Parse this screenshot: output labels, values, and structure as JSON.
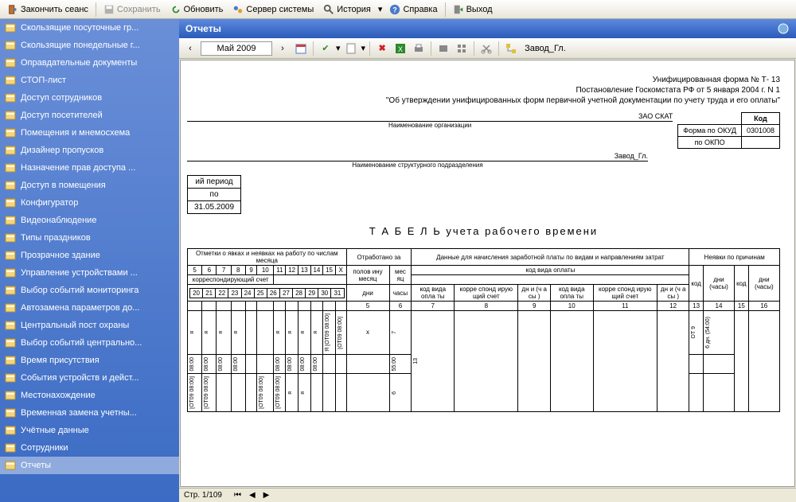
{
  "topToolbar": {
    "endSession": "Закончить сеанс",
    "save": "Сохранить",
    "refresh": "Обновить",
    "serverSystems": "Сервер системы",
    "history": "История",
    "help": "Справка",
    "exit": "Выход"
  },
  "sidebar": {
    "items": [
      "Скользящие посуточные гр...",
      "Скользящие понедельные г...",
      "Оправдательные документы",
      "СТОП-лист",
      "Доступ сотрудников",
      "Доступ посетителей",
      "Помещения и мнемосхема",
      "Дизайнер пропусков",
      "Назначение прав доступа ...",
      "Доступ в помещения",
      "Конфигуратор",
      "Видеонаблюдение",
      "Типы праздников",
      "Прозрачное здание",
      "Управление устройствами ...",
      "Выбор событий мониторинга",
      "Автозамена параметров до...",
      "Центральный пост охраны",
      "Выбор событий центрально...",
      "Время присутствия",
      "События устройств и дейст...",
      "Местонахождение",
      "Временная замена учетны...",
      "Учётные данные",
      "Сотрудники",
      "Отчеты"
    ],
    "activeIndex": 25
  },
  "titleBar": {
    "title": "Отчеты"
  },
  "subToolbar": {
    "prev": "‹",
    "next": "›",
    "date": "Май 2009",
    "zavod": "Завод_Гл."
  },
  "doc": {
    "formLine1": "Унифицированная  форма № Т- 13",
    "formLine2": "Постановление Госкомстата РФ от 5 января 2004 г. N 1",
    "formLine3": "\"Об утверждении унифицированных форм первичной учетной документации по учету труда и его оплаты\"",
    "orgName": "ЗАО СКАТ",
    "orgLabel": "Наименование организации",
    "divName": "Завод_Гл.",
    "divLabel": "Наименование структурного подразделения",
    "codeHeader": "Код",
    "okudLabel": "Форма по ОКУД",
    "okudVal": "0301008",
    "okpoLabel": "по ОКПО",
    "okpoVal": "",
    "periodLabel": "ий период",
    "periodPo": "по",
    "periodEnd": "31.05.2009",
    "title": "Т А Б Е Л Ь учета  рабочего  времени",
    "col_marks": "Отметки о явках и неявках на работу по числам месяца",
    "col_worked": "Отработано за",
    "col_payroll": "Данные для начисления заработной платы по  видам и направлениям затрат",
    "col_absence": "Неявки по причинам",
    "col_halfMonth": "полов ину месяц",
    "col_month": "мес яц",
    "col_payCode": "код вида оплаты",
    "col_corrAccount": "корреспондирующий счет",
    "col_days": "дни",
    "col_hours": "часы",
    "col_daysHours": "дни (часы)",
    "col_kod": "код",
    "col_payCodeS": "код вида опла ты",
    "col_corrS": "корре спонд ирую щий счет",
    "col_dnCha": "дн и (ч а сы )",
    "days1": [
      "5",
      "6",
      "7",
      "8",
      "9",
      "10",
      "11",
      "12",
      "13",
      "14",
      "15",
      "X"
    ],
    "days2": [
      "20",
      "21",
      "22",
      "23",
      "24",
      "25",
      "26",
      "27",
      "28",
      "29",
      "30",
      "31"
    ],
    "footerNums": [
      "5",
      "6",
      "7",
      "8",
      "9",
      "10",
      "11",
      "12",
      "13",
      "14",
      "15",
      "16"
    ],
    "r1_marks": [
      "я",
      "я",
      "я",
      "я",
      "",
      "",
      "я",
      "я",
      "я",
      "я",
      "Я [ОТ09 08:00]",
      "[ОТ09 08:00]"
    ],
    "r1_half": "7",
    "r1_month": "13",
    "r1_abs_code": "ОТ 9",
    "r1_abs_days": "6 дн. (54:00)",
    "r2_marks": [
      "08:00",
      "08:00",
      "08:00",
      "08:00",
      "",
      "",
      "08:00",
      "08:00",
      "08:00",
      "08:00",
      "",
      ""
    ],
    "r2_half": "55:00",
    "r3_marks": [
      "[ОТ09 08:00]",
      "[ОТ09 08:00]",
      "",
      "",
      "",
      "[ОТ09 08:00]",
      "[ОТ09 08:00]",
      "я",
      "я",
      "",
      "",
      ""
    ],
    "r3_half": "6"
  },
  "statusBar": {
    "page": "Стр. 1/109"
  }
}
